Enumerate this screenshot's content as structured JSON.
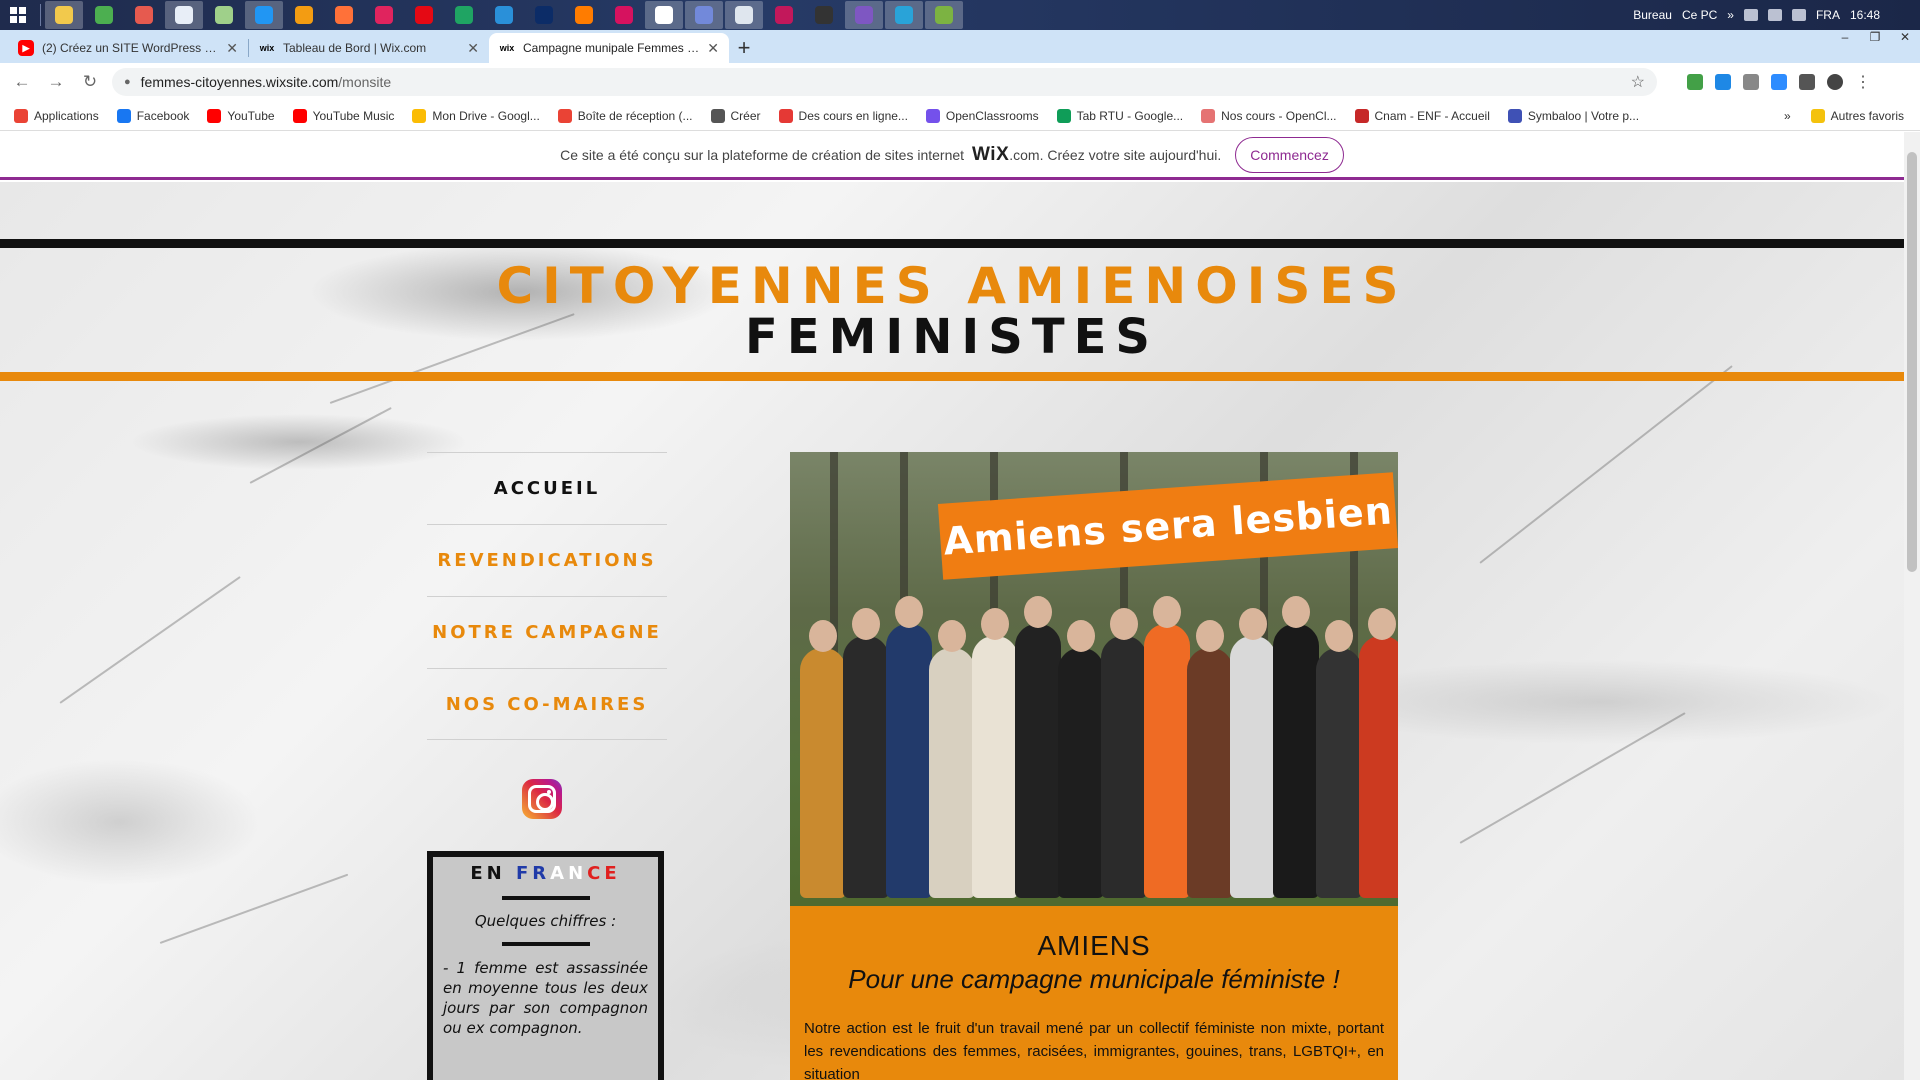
{
  "os": {
    "tray": {
      "desktop_label": "Bureau",
      "pc_label": "Ce PC",
      "more": "»",
      "language": "FRA",
      "time": "16:48"
    },
    "task_icons": [
      {
        "name": "file-explorer-icon",
        "color": "#f2c94c"
      },
      {
        "name": "app-icon-2",
        "color": "#4caf50"
      },
      {
        "name": "app-icon-3",
        "color": "#e65a4f"
      },
      {
        "name": "notepad-icon",
        "color": "#e8eef7"
      },
      {
        "name": "app-icon-5",
        "color": "#9fd08a"
      },
      {
        "name": "app-icon-6",
        "color": "#2196f3"
      },
      {
        "name": "vlc-icon",
        "color": "#f39c12"
      },
      {
        "name": "firefox-icon",
        "color": "#ff7139"
      },
      {
        "name": "app-icon-9",
        "color": "#e0245e"
      },
      {
        "name": "netflix-icon",
        "color": "#e50914"
      },
      {
        "name": "app-icon-11",
        "color": "#1fa463"
      },
      {
        "name": "vscode-icon",
        "color": "#2a90d9"
      },
      {
        "name": "photoshop-icon",
        "color": "#0c2c67"
      },
      {
        "name": "illustrator-icon",
        "color": "#ff7c00"
      },
      {
        "name": "indesign-icon",
        "color": "#d6125f"
      },
      {
        "name": "chrome-icon",
        "color": "#ffffff"
      },
      {
        "name": "discord-icon",
        "color": "#7289da"
      },
      {
        "name": "app-icon-18",
        "color": "#dfe6ee"
      },
      {
        "name": "app-icon-19",
        "color": "#c2185b"
      },
      {
        "name": "app-icon-20",
        "color": "#333333"
      },
      {
        "name": "app-icon-21",
        "color": "#7e57c2"
      },
      {
        "name": "app-icon-22",
        "color": "#29a3d8"
      },
      {
        "name": "app-icon-23",
        "color": "#7cb342"
      }
    ]
  },
  "browser": {
    "tabs": [
      {
        "title": "(2) Créez un SITE WordPress - Tu",
        "icon": "youtube-icon",
        "icon_color": "#ff0000",
        "active": false
      },
      {
        "title": "Tableau de Bord | Wix.com",
        "icon": "wix-icon",
        "icon_color": "#000000",
        "active": false
      },
      {
        "title": "Campagne munipale Femmes Cit",
        "icon": "wix-icon",
        "icon_color": "#000000",
        "active": true
      }
    ],
    "new_tab": "+",
    "url_host": "femmes-citoyennes.wixsite.com",
    "url_path": "/monsite",
    "bookmarks": [
      {
        "label": "Applications",
        "color": "#ea4335"
      },
      {
        "label": "Facebook",
        "color": "#1877f2"
      },
      {
        "label": "YouTube",
        "color": "#ff0000"
      },
      {
        "label": "YouTube Music",
        "color": "#ff0000"
      },
      {
        "label": "Mon Drive - Googl...",
        "color": "#fbbc04"
      },
      {
        "label": "Boîte de réception (...",
        "color": "#ea4335"
      },
      {
        "label": "Créer",
        "color": "#555555"
      },
      {
        "label": "Des cours en ligne...",
        "color": "#e53935"
      },
      {
        "label": "OpenClassrooms",
        "color": "#7451eb"
      },
      {
        "label": "Tab RTU - Google...",
        "color": "#0f9d58"
      },
      {
        "label": "Nos cours - OpenCl...",
        "color": "#e57373"
      },
      {
        "label": "Cnam - ENF - Accueil",
        "color": "#c62828"
      },
      {
        "label": "Symbaloo | Votre p...",
        "color": "#3f51b5"
      }
    ],
    "bookmarks_more": "»",
    "other_bookmarks": "Autres favoris"
  },
  "wix_banner": {
    "text_before": "Ce site a été conçu sur la plateforme de création de sites internet",
    "logo": "WiX",
    "text_after": ".com. Créez votre site aujourd'hui.",
    "cta": "Commencez"
  },
  "site": {
    "title_line1": "CITOYENNES AMIENOISES",
    "title_line2": "FEMINISTES",
    "nav": [
      {
        "label": "ACCUEIL",
        "active": true
      },
      {
        "label": "REVENDICATIONS",
        "active": false
      },
      {
        "label": "NOTRE CAMPAGNE",
        "active": false
      },
      {
        "label": "NOS CO-MAIRES",
        "active": false
      }
    ],
    "france_box": {
      "title_en": "EN",
      "title_fr": "FR",
      "title_an": "AN",
      "title_ce": "CE",
      "subtitle": "Quelques chiffres :",
      "text": "- 1 femme est assassinée en moyenne tous les deux jours par son compagnon ou ex compagnon."
    },
    "photo_banner": "Amiens sera lesbien",
    "caption": {
      "title": "AMIENS",
      "subtitle": "Pour une campagne municipale féministe !",
      "body": "Notre action est le fruit d'un travail mené par un collectif féministe non mixte, portant les revendications des femmes, racisées, immigrantes, gouines, trans, LGBTQI+, en situation"
    }
  }
}
